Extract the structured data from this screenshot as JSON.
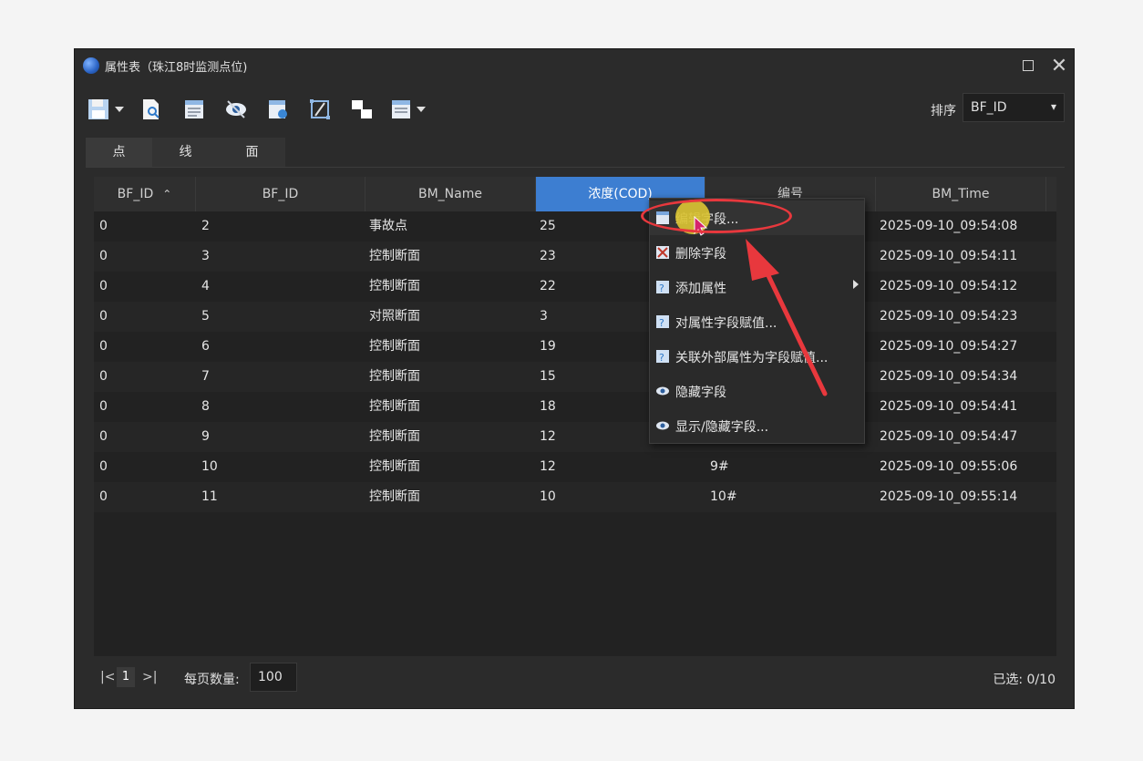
{
  "window": {
    "title": "属性表（珠江8时监测点位)",
    "controls": [
      "maximize-icon",
      "close-icon"
    ]
  },
  "toolbar": {
    "icons": [
      "save-icon",
      "search-document-icon",
      "edit-table-icon",
      "hide-eye-icon",
      "field-calc-icon",
      "select-area-icon",
      "switch-selection-icon",
      "table-options-icon"
    ],
    "sort_label": "排序",
    "sort_value": "BF_ID"
  },
  "tabs": [
    {
      "label": "点",
      "active": true
    },
    {
      "label": "线",
      "active": false
    },
    {
      "label": "面",
      "active": false
    }
  ],
  "table": {
    "columns": [
      "BF_ID",
      "BF_ID",
      "BM_Name",
      "浓度(COD)",
      "编号",
      "BM_Time"
    ],
    "sorted_column_index": 0,
    "selected_column_index": 3,
    "rows": [
      [
        "0",
        "2",
        "事故点",
        "25",
        "",
        "2025-09-10_09:54:08"
      ],
      [
        "0",
        "3",
        "控制断面",
        "23",
        "",
        "2025-09-10_09:54:11"
      ],
      [
        "0",
        "4",
        "控制断面",
        "22",
        "",
        "2025-09-10_09:54:12"
      ],
      [
        "0",
        "5",
        "对照断面",
        "3",
        "",
        "2025-09-10_09:54:23"
      ],
      [
        "0",
        "6",
        "控制断面",
        "19",
        "",
        "2025-09-10_09:54:27"
      ],
      [
        "0",
        "7",
        "控制断面",
        "15",
        "",
        "2025-09-10_09:54:34"
      ],
      [
        "0",
        "8",
        "控制断面",
        "18",
        "",
        "2025-09-10_09:54:41"
      ],
      [
        "0",
        "9",
        "控制断面",
        "12",
        "",
        "2025-09-10_09:54:47"
      ],
      [
        "0",
        "10",
        "控制断面",
        "12",
        "9#",
        "2025-09-10_09:55:06"
      ],
      [
        "0",
        "11",
        "控制断面",
        "10",
        "10#",
        "2025-09-10_09:55:14"
      ]
    ]
  },
  "context_menu": {
    "items": [
      {
        "label": "编辑字段...",
        "icon": "edit-field-icon",
        "submenu": false,
        "highlighted": true
      },
      {
        "label": "删除字段",
        "icon": "delete-field-icon",
        "submenu": false
      },
      {
        "label": "添加属性",
        "icon": "add-attribute-icon",
        "submenu": true
      },
      {
        "label": "对属性字段赋值...",
        "icon": "assign-field-icon",
        "submenu": false
      },
      {
        "label": "关联外部属性为字段赋值...",
        "icon": "link-external-icon",
        "submenu": false
      },
      {
        "label": "隐藏字段",
        "icon": "hide-field-icon",
        "submenu": false
      },
      {
        "label": "显示/隐藏字段...",
        "icon": "show-hide-field-icon",
        "submenu": false
      }
    ]
  },
  "footer": {
    "first_page": "|<",
    "current_page": "1",
    "last_page": ">|",
    "page_size_label": "每页数量:",
    "page_size_value": "100",
    "selected_status": "已选: 0/10"
  },
  "colors": {
    "accent": "#3d7ed1",
    "annotation": "#e8383d",
    "cursor": "#d9c233"
  }
}
